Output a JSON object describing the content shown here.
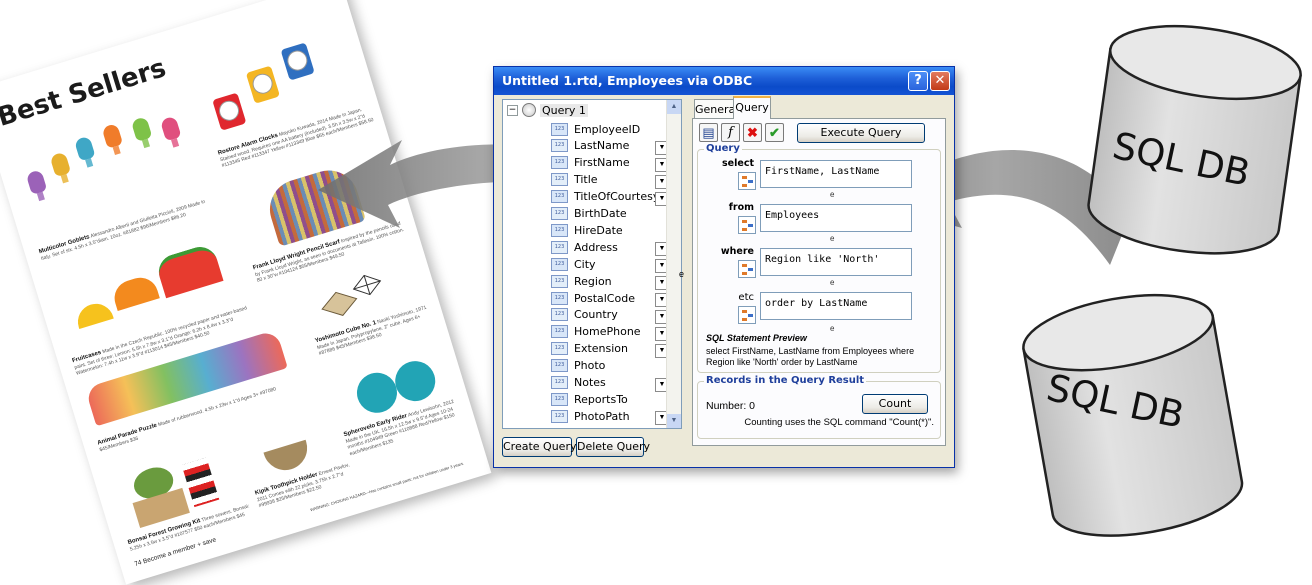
{
  "dialog": {
    "title": "Untitled 1.rtd, Employees via ODBC",
    "help_glyph": "?",
    "close_glyph": "✕",
    "query_node": "Query 1",
    "fields": [
      {
        "name": "EmployeeID",
        "has_combo": false
      },
      {
        "name": "LastName",
        "has_combo": true
      },
      {
        "name": "FirstName",
        "has_combo": true
      },
      {
        "name": "Title",
        "has_combo": true
      },
      {
        "name": "TitleOfCourtesy",
        "has_combo": true
      },
      {
        "name": "BirthDate",
        "has_combo": false
      },
      {
        "name": "HireDate",
        "has_combo": false
      },
      {
        "name": "Address",
        "has_combo": true
      },
      {
        "name": "City",
        "has_combo": true
      },
      {
        "name": "Region",
        "has_combo": true
      },
      {
        "name": "PostalCode",
        "has_combo": true
      },
      {
        "name": "Country",
        "has_combo": true
      },
      {
        "name": "HomePhone",
        "has_combo": true
      },
      {
        "name": "Extension",
        "has_combo": true
      },
      {
        "name": "Photo",
        "has_combo": false
      },
      {
        "name": "Notes",
        "has_combo": true
      },
      {
        "name": "ReportsTo",
        "has_combo": false
      },
      {
        "name": "PhotoPath",
        "has_combo": true
      }
    ],
    "buttons": {
      "create_query": "Create Query",
      "delete_query": "Delete Query",
      "execute": "Execute Query",
      "count": "Count"
    },
    "tabs": {
      "general": "General",
      "query": "Query"
    },
    "query_group": "Query",
    "clauses": {
      "select_label": "select",
      "select_value": "FirstName, LastName",
      "from_label": "from",
      "from_value": "Employees",
      "where_label": "where",
      "where_value": "Region like 'North'",
      "etc_label": "etc",
      "etc_value": "order by LastName"
    },
    "etc_mark": "e",
    "preview_label": "SQL Statement Preview",
    "preview_text": "select FirstName, LastName from Employees where Region like 'North' order by LastName",
    "results_group": "Records in the Query Result",
    "number_label": "Number: 0",
    "count_note": "Counting uses the SQL command \"Count(*)\".",
    "side_mark": "e"
  },
  "catalog": {
    "heading": "Best Sellers",
    "captions": [
      {
        "title": "Multicolor Goblets",
        "text": "Alessandro Alberti and Giulietta Piccioli, 2009 Made in Italy. Set of six. 4.5h x 3.5\"diam. 10oz. #81882 $96/Members $86.20"
      },
      {
        "title": "Rostore Alarm Clocks",
        "text": "Mayuko Kuwada, 2014 Made in Japan. Stained wood. Requires one AA battery (included). 3.5h x 3.5w x 2\"d #113345 Red #113347 Yellow #113349 Blue $65 each/Members $58.50"
      },
      {
        "title": "Frank Lloyd Wright Pencil Scarf",
        "text": "Inspired by the pencils used by Frank Lloyd Wright, as seen in documents at Taliesin. 100% cotton. 80 x 30\"w #104124 $55/Members $49.50"
      },
      {
        "title": "Fruitcases",
        "text": "Made in the Czech Republic. 100% recycled paper and water-based paint. Set of three: Lemon: 5.5h x 7.8w x 3.1\"d Orange: 6.2h x 8.4w x 3.3\"d Watermelon: 7.4h x 11w x 3.9\"d #113014 $45/Members $40.50"
      },
      {
        "title": "Yoshimoto Cube No. 1",
        "text": "Naoki Yoshimoto, 1971 Made in Japan. Polypropylene. 2\" cube. Ages 6+ #87886 $45/Members $38.50"
      },
      {
        "title": "Animal Parade Puzzle",
        "text": "Made of rubberwood. 4.5h x 23w x 1\"d Ages 3+ #97080 $45/Members $36"
      },
      {
        "title": "Spherovelo Early Rider",
        "text": "Andy Lewisohn, 2012 Made in the UK. 16.5h x 12.5w x 9.5\"d Ages 10-24 months #104949 Green #110888 Red/Yellow $150 each/Members $135"
      },
      {
        "title": "Kipik Toothpick Holder",
        "text": "Ernest Pavlov, 2011 Comes with 22 picks. 3.75h x 2.7\"d #99938 $25/Members $22.50"
      },
      {
        "title": "Bonsai Forest Growing Kit",
        "text": "Three sowers. Bonsai: 5.25h x 3.5w x 3.5\"d #107577 $50 each/Members $45"
      }
    ],
    "footer": "74   Become a member + save",
    "warning": "WARNING: CHOKING HAZARD—Has contains small parts; not for children under 3 years."
  },
  "databases": [
    {
      "label": "SQL DB"
    },
    {
      "label": "SQL DB"
    }
  ],
  "colors": {
    "titlebar": "#0b4bc9",
    "dialog_bg": "#ece9d8",
    "group_title": "#1f3f9b",
    "cylinder": "#d9d9d9",
    "arrow": "#8c8c8c"
  }
}
